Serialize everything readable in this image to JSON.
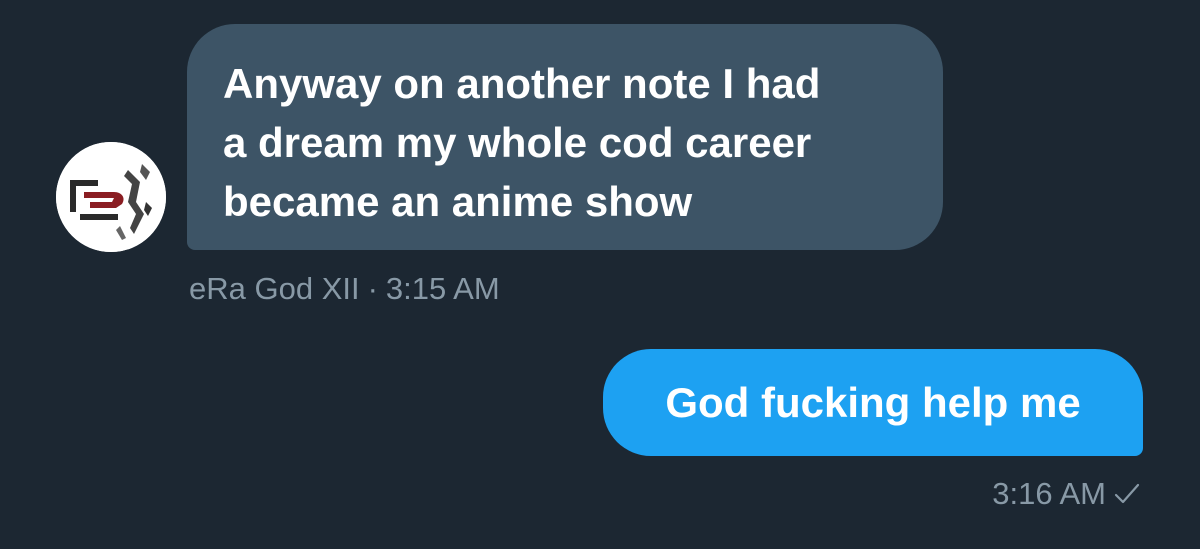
{
  "conversation": {
    "incoming": {
      "lines": [
        "Anyway on another note I had",
        "a dream my whole cod career",
        "became an anime show"
      ],
      "sender": "eRa God XII",
      "separator": "·",
      "time": "3:15 AM"
    },
    "outgoing": {
      "text": "God fucking help me",
      "time": "3:16 AM",
      "status_icon": "checkmark-icon"
    }
  },
  "colors": {
    "background": "#1c2732",
    "incoming_bubble": "#3d5466",
    "outgoing_bubble": "#1da1f2",
    "meta_text": "#8899a6"
  }
}
